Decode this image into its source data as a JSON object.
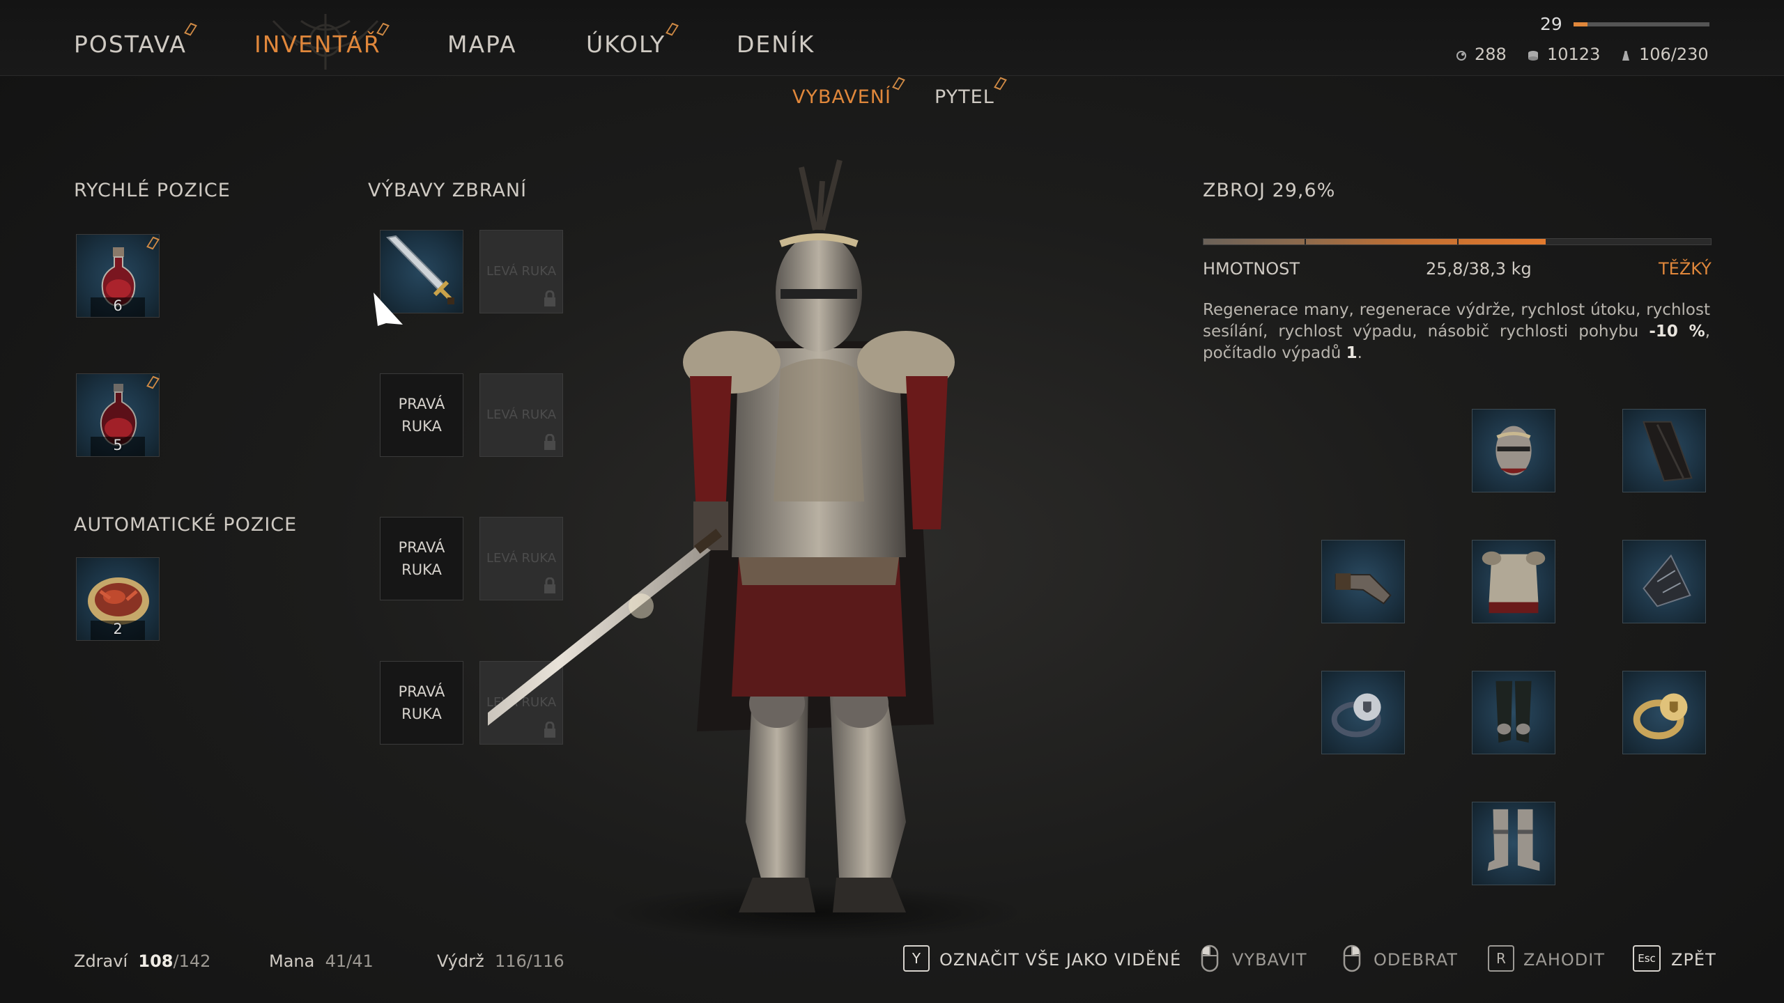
{
  "nav": {
    "tabs": [
      {
        "label": "POSTAVA",
        "new": true
      },
      {
        "label": "INVENTÁŘ",
        "new": true,
        "active": true
      },
      {
        "label": "MAPA",
        "new": false
      },
      {
        "label": "ÚKOLY",
        "new": true
      },
      {
        "label": "DENÍK",
        "new": false
      }
    ]
  },
  "player": {
    "level": "29",
    "xp_fraction": 0.1,
    "souls": "288",
    "gold": "10123",
    "load": "106/230"
  },
  "subtabs": [
    {
      "label": "VYBAVENÍ",
      "active": true,
      "new": true
    },
    {
      "label": "PYTEL",
      "active": false,
      "new": true
    }
  ],
  "quick_slots": {
    "title": "RYCHLÉ POZICE",
    "items": [
      {
        "icon": "health-potion-icon",
        "count": "6",
        "new": true
      },
      {
        "icon": "mana-potion-icon",
        "count": "5",
        "new": true
      }
    ]
  },
  "auto_slots": {
    "title": "AUTOMATICKÉ POZICE",
    "items": [
      {
        "icon": "food-plate-icon",
        "count": "2"
      }
    ]
  },
  "weapon_sets": {
    "title": "VÝBAVY ZBRANÍ",
    "right_label": "PRAVÁ RUKA",
    "left_label": "LEVÁ RUKA",
    "rows": [
      {
        "right": "sword-icon",
        "left_locked": true
      },
      {
        "right": null,
        "left_locked": true
      },
      {
        "right": null,
        "left_locked": true
      },
      {
        "right": null,
        "left_locked": true
      }
    ]
  },
  "armor": {
    "title": "ZBROJ 29,6%",
    "weight_label": "HMOTNOST",
    "weight_value": "25,8/38,3 kg",
    "weight_class": "TĚŽKÝ",
    "weight_fraction": 0.674,
    "description_plain": "Regenerace many, regenerace výdrže, rychlost útoku, rychlost sesílání, rychlost výpadu, násobič rychlosti pohybu ",
    "description_bold1": "-10 %",
    "description_mid": ", počítadlo výpadů ",
    "description_bold2": "1",
    "description_end": "."
  },
  "equipment": [
    {
      "slot": "helmet",
      "icon": "helmet-icon"
    },
    {
      "slot": "cape",
      "icon": "cape-icon"
    },
    {
      "slot": "gloves",
      "icon": "gauntlet-icon"
    },
    {
      "slot": "chest",
      "icon": "chest-armor-icon"
    },
    {
      "slot": "amulet",
      "icon": "rune-stone-icon"
    },
    {
      "slot": "ring-left",
      "icon": "ring-shield-icon"
    },
    {
      "slot": "legs",
      "icon": "leg-armor-icon"
    },
    {
      "slot": "ring-right",
      "icon": "gold-ring-icon"
    },
    {
      "slot": "boots",
      "icon": "boots-icon"
    }
  ],
  "vitals": {
    "health_label": "Zdraví",
    "health_current": "108",
    "health_max": "/142",
    "mana_label": "Mana",
    "mana_value": "41/41",
    "stamina_label": "Výdrž",
    "stamina_value": "116/116"
  },
  "hints": [
    {
      "key": "Y",
      "label": "OZNAČIT VŠE JAKO VIDĚNÉ"
    },
    {
      "key": "mouse-left",
      "label": "VYBAVIT"
    },
    {
      "key": "mouse-right",
      "label": "ODEBRAT"
    },
    {
      "key": "R",
      "label": "ZAHODIT"
    },
    {
      "key": "Esc",
      "label": "ZPĚT"
    }
  ],
  "colors": {
    "accent": "#e0873b",
    "slot_blue": "#1d3445"
  }
}
